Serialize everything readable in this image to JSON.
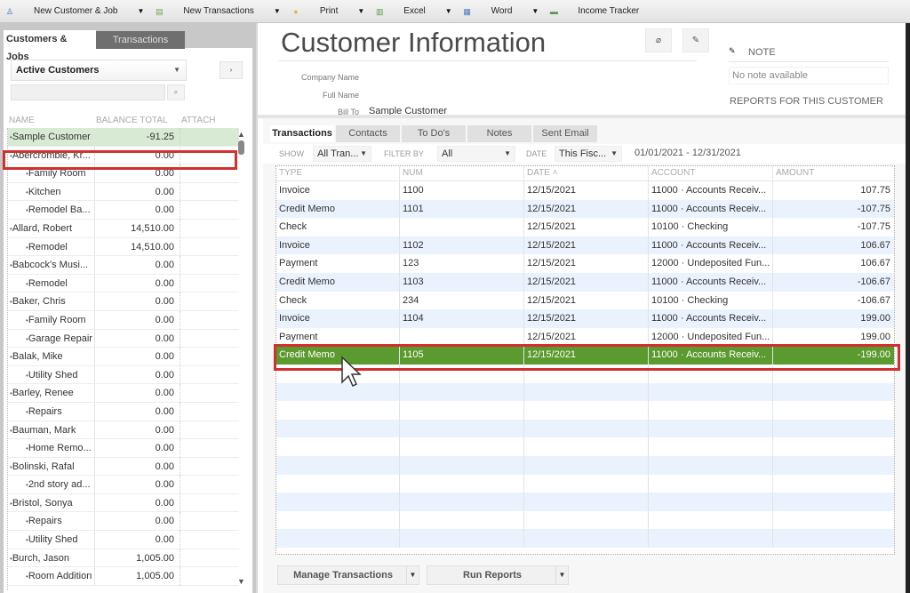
{
  "toolbar": {
    "items": [
      {
        "label": "New Customer & Job",
        "icon": "new-customer-icon"
      },
      {
        "label": "New Transactions",
        "icon": "new-transaction-icon"
      },
      {
        "label": "Print",
        "icon": "print-icon"
      },
      {
        "label": "Excel",
        "icon": "excel-icon"
      },
      {
        "label": "Word",
        "icon": "word-icon"
      },
      {
        "label": "Income Tracker",
        "icon": "income-tracker-icon"
      }
    ]
  },
  "left": {
    "tabs": [
      "Customers & Jobs",
      "Transactions"
    ],
    "filter_selected": "Active Customers",
    "search_value": "",
    "columns": [
      "NAME",
      "BALANCE TOTAL",
      "ATTACH"
    ],
    "customers": [
      {
        "name": "Sample Customer",
        "balance": "-91.25",
        "level": 0,
        "selected": true
      },
      {
        "name": "Abercrombie, Kr...",
        "balance": "0.00",
        "level": 0
      },
      {
        "name": "Family Room",
        "balance": "0.00",
        "level": 1
      },
      {
        "name": "Kitchen",
        "balance": "0.00",
        "level": 1
      },
      {
        "name": "Remodel Ba...",
        "balance": "0.00",
        "level": 1
      },
      {
        "name": "Allard, Robert",
        "balance": "14,510.00",
        "level": 0
      },
      {
        "name": "Remodel",
        "balance": "14,510.00",
        "level": 1
      },
      {
        "name": "Babcock's Musi...",
        "balance": "0.00",
        "level": 0
      },
      {
        "name": "Remodel",
        "balance": "0.00",
        "level": 1
      },
      {
        "name": "Baker, Chris",
        "balance": "0.00",
        "level": 0
      },
      {
        "name": "Family Room",
        "balance": "0.00",
        "level": 1
      },
      {
        "name": "Garage Repair",
        "balance": "0.00",
        "level": 1
      },
      {
        "name": "Balak, Mike",
        "balance": "0.00",
        "level": 0
      },
      {
        "name": "Utility Shed",
        "balance": "0.00",
        "level": 1
      },
      {
        "name": "Barley, Renee",
        "balance": "0.00",
        "level": 0
      },
      {
        "name": "Repairs",
        "balance": "0.00",
        "level": 1
      },
      {
        "name": "Bauman, Mark",
        "balance": "0.00",
        "level": 0
      },
      {
        "name": "Home Remo...",
        "balance": "0.00",
        "level": 1
      },
      {
        "name": "Bolinski, Rafal",
        "balance": "0.00",
        "level": 0
      },
      {
        "name": "2nd story ad...",
        "balance": "0.00",
        "level": 1
      },
      {
        "name": "Bristol, Sonya",
        "balance": "0.00",
        "level": 0
      },
      {
        "name": "Repairs",
        "balance": "0.00",
        "level": 1
      },
      {
        "name": "Utility Shed",
        "balance": "0.00",
        "level": 1
      },
      {
        "name": "Burch, Jason",
        "balance": "1,005.00",
        "level": 0
      },
      {
        "name": "Room Addition",
        "balance": "1,005.00",
        "level": 1
      }
    ]
  },
  "info": {
    "title": "Customer Information",
    "labels": {
      "company": "Company Name",
      "full_name": "Full Name",
      "bill_to": "Bill To"
    },
    "bill_to_value": "Sample Customer",
    "note_label": "NOTE",
    "note_text": "No note available",
    "reports_label": "REPORTS FOR THIS CUSTOMER"
  },
  "transactions": {
    "tabs": [
      "Transactions",
      "Contacts",
      "To Do's",
      "Notes",
      "Sent Email"
    ],
    "show_label": "SHOW",
    "show_value": "All Tran...",
    "filter_label": "FILTER BY",
    "filter_value": "All",
    "date_label": "DATE",
    "date_value": "This Fisc...",
    "date_range": "01/01/2021 - 12/31/2021",
    "columns": [
      "TYPE",
      "NUM",
      "DATE ˄",
      "ACCOUNT",
      "AMOUNT"
    ],
    "rows": [
      {
        "type": "Invoice",
        "num": "1100",
        "date": "12/15/2021",
        "account": "11000 · Accounts Receiv...",
        "amount": "107.75"
      },
      {
        "type": "Credit Memo",
        "num": "1101",
        "date": "12/15/2021",
        "account": "11000 · Accounts Receiv...",
        "amount": "-107.75"
      },
      {
        "type": "Check",
        "num": "",
        "date": "12/15/2021",
        "account": "10100 · Checking",
        "amount": "-107.75"
      },
      {
        "type": "Invoice",
        "num": "1102",
        "date": "12/15/2021",
        "account": "11000 · Accounts Receiv...",
        "amount": "106.67"
      },
      {
        "type": "Payment",
        "num": "123",
        "date": "12/15/2021",
        "account": "12000 · Undeposited Fun...",
        "amount": "106.67"
      },
      {
        "type": "Credit Memo",
        "num": "1103",
        "date": "12/15/2021",
        "account": "11000 · Accounts Receiv...",
        "amount": "-106.67"
      },
      {
        "type": "Check",
        "num": "234",
        "date": "12/15/2021",
        "account": "10100 · Checking",
        "amount": "-106.67"
      },
      {
        "type": "Invoice",
        "num": "1104",
        "date": "12/15/2021",
        "account": "11000 · Accounts Receiv...",
        "amount": "199.00"
      },
      {
        "type": "Payment",
        "num": "",
        "date": "12/15/2021",
        "account": "12000 · Undeposited Fun...",
        "amount": "199.00"
      },
      {
        "type": "Credit Memo",
        "num": "1105",
        "date": "12/15/2021",
        "account": "11000 · Accounts Receiv...",
        "amount": "-199.00",
        "selected": true
      }
    ],
    "empty_rows": 10,
    "manage_label": "Manage Transactions",
    "reports_label": "Run Reports"
  },
  "colors": {
    "selected_row": "#5b9a2e",
    "selected_customer": "#d8ead3",
    "highlight_frame": "#d32f2f",
    "alt_row": "#eaf2fd"
  }
}
